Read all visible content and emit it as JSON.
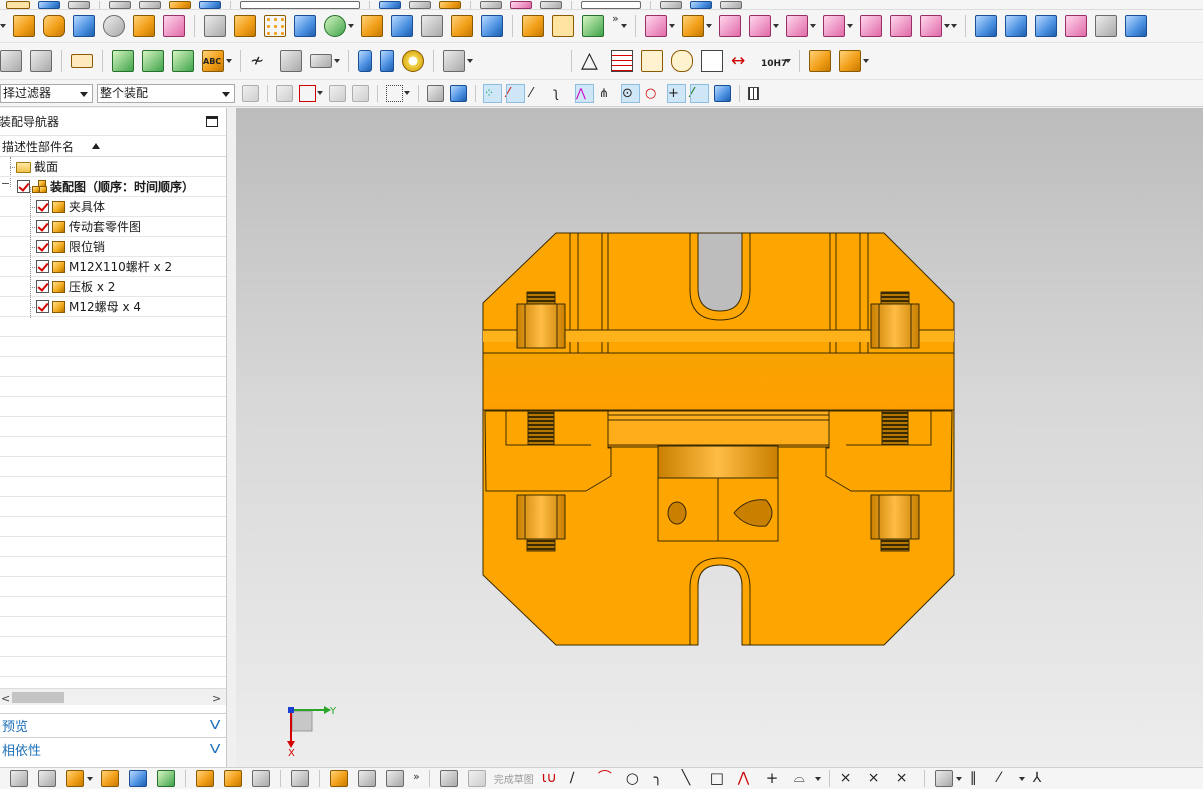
{
  "toolbar": {
    "part_filter_value": "择过滤器",
    "assembly_scope_value": "整个装配",
    "tolerance_label": "10H7",
    "text_icon_label": "ABC",
    "overflow_glyph": "»"
  },
  "navigator": {
    "title": "装配导航器",
    "column_header": "描述性部件名",
    "rows": [
      {
        "label": "截面",
        "type": "folder"
      },
      {
        "label": "装配图（顺序：时间顺序）",
        "type": "assembly"
      },
      {
        "label": "夹具体",
        "type": "part"
      },
      {
        "label": "传动套零件图",
        "type": "part"
      },
      {
        "label": "限位销",
        "type": "part"
      },
      {
        "label": "M12X110螺杆 x 2",
        "type": "part"
      },
      {
        "label": "压板 x 2",
        "type": "part"
      },
      {
        "label": "M12螺母 x 4",
        "type": "part"
      }
    ],
    "preview_label": "预览",
    "dependency_label": "相依性",
    "expand_glyph": "V",
    "scroll_left": "<",
    "scroll_right": ">"
  },
  "viewport": {
    "triad_y_label": "Y",
    "triad_x_label": "X",
    "model_color": "#FFA500",
    "model_shade": "#E89400",
    "edge_color": "#3a2a00"
  },
  "bottom": {
    "finish_sketch_label": "完成草图"
  }
}
